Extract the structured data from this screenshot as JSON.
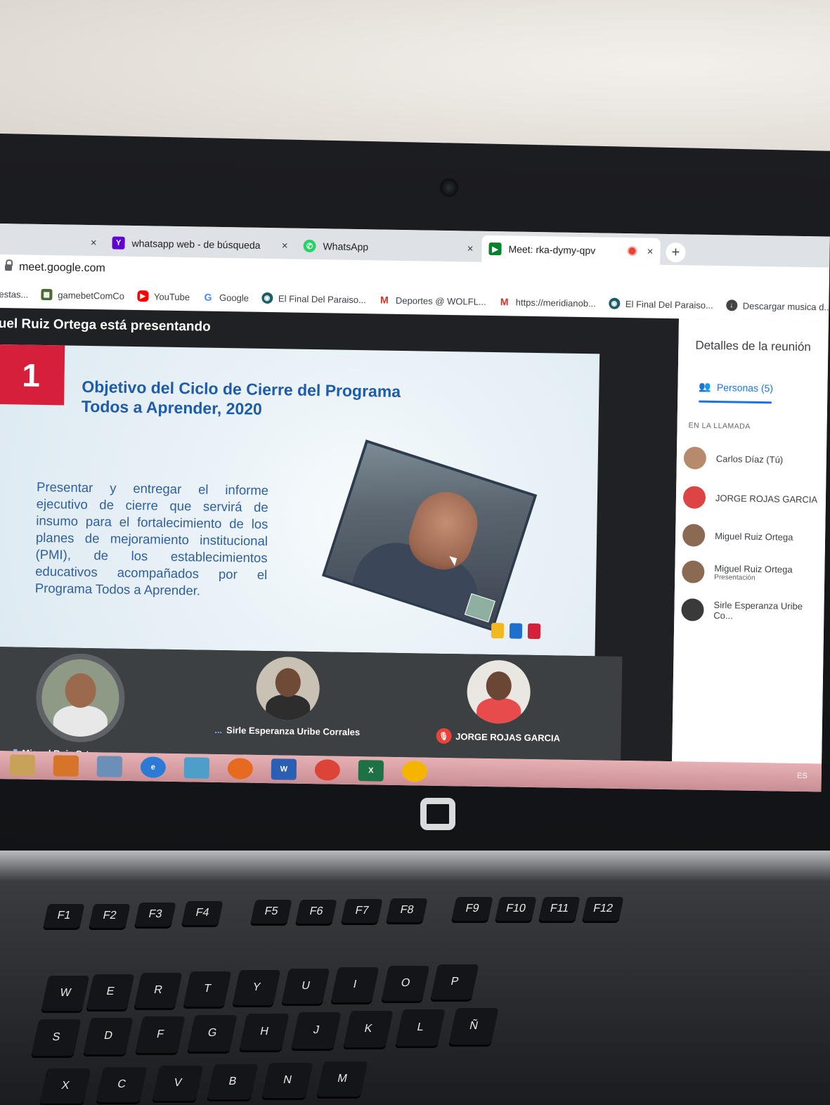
{
  "browser": {
    "tabs": [
      {
        "label": "",
        "close": "×"
      },
      {
        "label": "whatsapp web - de búsqueda",
        "close": "×",
        "icon": "yahoo-icon"
      },
      {
        "label": "WhatsApp",
        "close": "×",
        "icon": "whatsapp-icon"
      },
      {
        "label": "Meet: rka-dymy-qpv",
        "close": "×",
        "icon": "meet-icon",
        "active": true
      }
    ],
    "new_tab": "+",
    "url": "meet.google.com",
    "bookmarks": [
      {
        "label": "estas...",
        "icon": "folder-icon"
      },
      {
        "label": "gamebetComCo",
        "icon": "game-icon"
      },
      {
        "label": "YouTube",
        "icon": "youtube-icon"
      },
      {
        "label": "Google",
        "icon": "google-icon"
      },
      {
        "label": "El Final Del Paraiso...",
        "icon": "globe-icon"
      },
      {
        "label": "Deportes @ WOLFL...",
        "icon": "gmail-icon"
      },
      {
        "label": "https://meridianob...",
        "icon": "gmail-icon"
      },
      {
        "label": "El Final Del Paraiso...",
        "icon": "globe-icon"
      },
      {
        "label": "Descargar musica d...",
        "icon": "download-icon"
      }
    ]
  },
  "meet": {
    "presenting": "uel Ruiz Ortega está presentando",
    "slide": {
      "number": "1",
      "title": "Objetivo del Ciclo de Cierre del Programa Todos a Aprender, 2020",
      "body": "Presentar y entregar el informe ejecutivo de cierre que servirá de insumo para el fortalecimiento de los planes de mejoramiento institucional (PMI), de los establecimientos educativos acompañados por el Programa Todos a Aprender."
    },
    "tiles": [
      {
        "name": "Miguel Ruiz Ortega",
        "status": "speaking"
      },
      {
        "name": "Sirle Esperanza Uribe Corrales",
        "status": "..."
      },
      {
        "name": "JORGE ROJAS GARCIA",
        "status": "muted"
      }
    ]
  },
  "panel": {
    "title": "Detalles de la reunión",
    "tab": "Personas (5)",
    "section": "EN LA LLAMADA",
    "people": [
      {
        "name": "Carlos Díaz (Tú)",
        "sub": ""
      },
      {
        "name": "JORGE ROJAS GARCIA",
        "sub": ""
      },
      {
        "name": "Miguel Ruiz Ortega",
        "sub": ""
      },
      {
        "name": "Miguel Ruiz Ortega",
        "sub": "Presentación"
      },
      {
        "name": "Sirle Esperanza Uribe Co...",
        "sub": ""
      }
    ]
  },
  "taskbar": {
    "tray": "ES"
  },
  "keyboard": {
    "function_row": [
      "F1",
      "F2",
      "F3",
      "F4",
      "F5",
      "F6",
      "F7",
      "F8",
      "F9",
      "F10",
      "F11",
      "F12"
    ],
    "letters_row1": [
      "W",
      "E",
      "R",
      "T",
      "Y",
      "U",
      "I",
      "O",
      "P"
    ],
    "letters_row2": [
      "S",
      "D",
      "F",
      "G",
      "H",
      "J",
      "K",
      "L",
      "Ñ"
    ],
    "letters_row3": [
      "X",
      "C",
      "V",
      "B",
      "N",
      "M"
    ]
  }
}
